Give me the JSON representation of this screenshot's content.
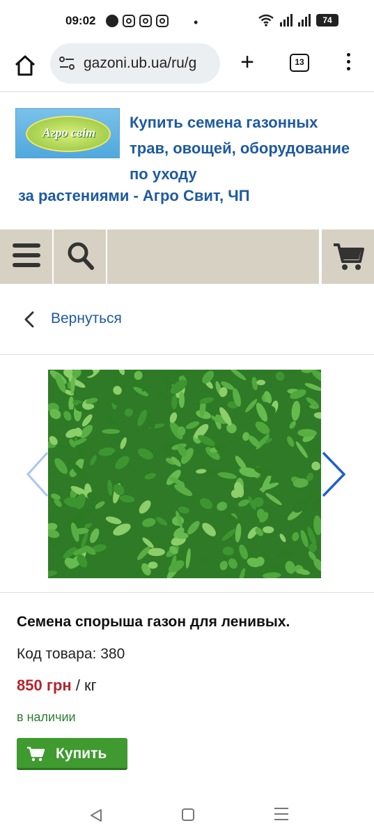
{
  "status_bar": {
    "time": "09:02",
    "battery": "74",
    "apps": [
      "facebook-icon",
      "instagram-icon",
      "instagram-icon",
      "instagram-icon"
    ],
    "dot": "•"
  },
  "browser": {
    "url": "gazoni.ub.ua/ru/g",
    "tab_count": "13",
    "new_tab_symbol": "+"
  },
  "site": {
    "logo_text": "Агро світ",
    "title_line1": "Купить семена газонных трав, овощей, оборудование по уходу",
    "title_line2": "за растениями - Агро Свит, ЧП"
  },
  "nav": {
    "back_label": "Вернуться"
  },
  "product": {
    "name": "Семена спорыша газон для ленивых.",
    "code": "Код товара: 380",
    "price": "850 грн",
    "unit": " / кг",
    "stock": "в наличии",
    "buy_label": "Купить"
  },
  "colors": {
    "accent_blue": "#1e5aa0",
    "price_red": "#b5242d",
    "buy_green": "#3f9a2f",
    "nav_beige": "#d7d1c3"
  }
}
